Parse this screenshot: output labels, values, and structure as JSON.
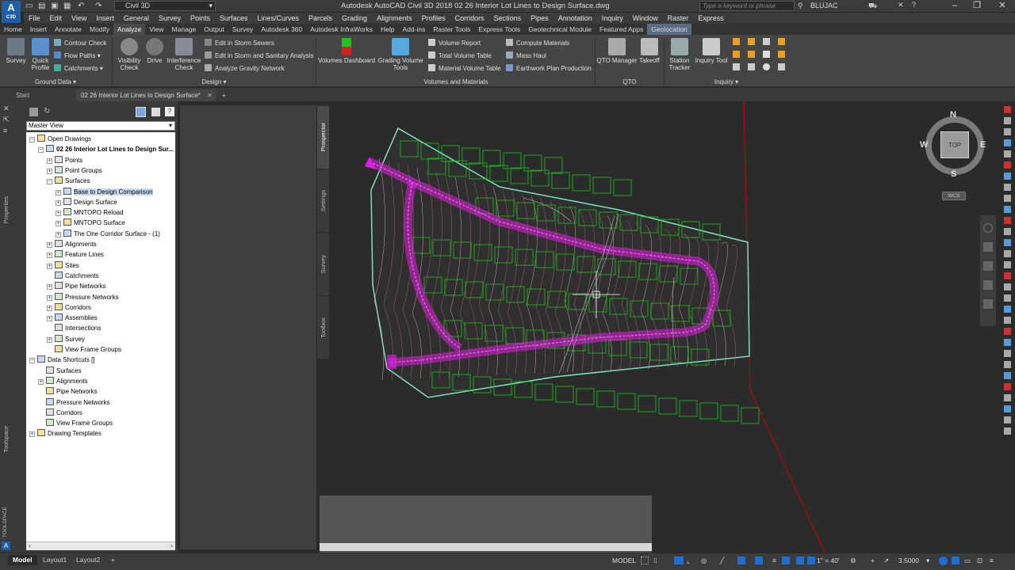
{
  "app": {
    "logo": "A",
    "logo_sub": "C3D",
    "title": "Autodesk AutoCAD Civil 3D 2018    02 26 Interior Lot Lines to Design Surface.dwg",
    "workspace": "Civil 3D",
    "search_placeholder": "Type a keyword or phrase",
    "user": "BLUJAC"
  },
  "menu": [
    "File",
    "Edit",
    "View",
    "Insert",
    "General",
    "Survey",
    "Points",
    "Surfaces",
    "Lines/Curves",
    "Parcels",
    "Grading",
    "Alignments",
    "Profiles",
    "Corridors",
    "Sections",
    "Pipes",
    "Annotation",
    "Inquiry",
    "Window",
    "Raster",
    "Express"
  ],
  "ribbon_tabs": [
    "Home",
    "Insert",
    "Annotate",
    "Modify",
    "Analyze",
    "View",
    "Manage",
    "Output",
    "Survey",
    "Autodesk 360",
    "Autodesk InfraWorks",
    "Help",
    "Add-ins",
    "Raster Tools",
    "Express Tools",
    "Geotechnical Module",
    "Featured Apps",
    "Geolocation"
  ],
  "ribbon": {
    "ground_data": {
      "title": "Ground Data",
      "survey": "Survey",
      "quick_profile": "Quick Profile",
      "contour_check": "Contour Check",
      "flow_paths": "Flow Paths",
      "catchments": "Catchments"
    },
    "design": {
      "title": "Design",
      "visibility_check": "Visibility Check",
      "drive": "Drive",
      "interference_check": "Interference Check",
      "edit_storm": "Edit in Storm Sewers",
      "edit_storm_sanitary": "Edit in Storm and Sanitary Analysis",
      "analyze_gravity": "Analyze Gravity Network"
    },
    "volumes": {
      "title": "Volumes and Materials",
      "volumes_dashboard": "Volumes Dashboard",
      "grading_volume_tools": "Grading Volume Tools",
      "volume_report": "Volume Report",
      "total_volume_table": "Total Volume Table",
      "material_volume_table": "Material Volume Table",
      "compute_materials": "Compute Materials",
      "mass_haul": "Mass Haul",
      "earthwork_plan": "Earthwork Plan Production"
    },
    "qto": {
      "title": "QTO",
      "qto_manager": "QTO Manager",
      "takeoff": "Takeoff"
    },
    "inquiry": {
      "title": "Inquiry",
      "station_tracker": "Station Tracker",
      "inquiry_tool": "Inquiry Tool"
    }
  },
  "file_tabs": {
    "start": "Start",
    "active": "02 26 Interior Lot Lines to Design Surface*"
  },
  "toolspace": {
    "view_select": "Master View",
    "side_label": "TOOLSPACE",
    "properties_label": "Properties",
    "toolspace_label": "Toolspace",
    "tree": [
      {
        "label": "Open Drawings",
        "indent": 0,
        "exp": "-"
      },
      {
        "label": "02 26 Interior Lot Lines to Design Sur...",
        "indent": 1,
        "exp": "-",
        "bold": true
      },
      {
        "label": "Points",
        "indent": 2,
        "exp": "+"
      },
      {
        "label": "Point Groups",
        "indent": 2,
        "exp": "+"
      },
      {
        "label": "Surfaces",
        "indent": 2,
        "exp": "-"
      },
      {
        "label": "Base to Design Comparison",
        "indent": 3,
        "exp": "+",
        "sel": true
      },
      {
        "label": "Design Surface",
        "indent": 3,
        "exp": "+"
      },
      {
        "label": "MNTOPO Reload",
        "indent": 3,
        "exp": "+"
      },
      {
        "label": "MNTOPO Surface",
        "indent": 3,
        "exp": "+"
      },
      {
        "label": "The One Corridor Surface - (1)",
        "indent": 3,
        "exp": "+"
      },
      {
        "label": "Alignments",
        "indent": 2,
        "exp": "+"
      },
      {
        "label": "Feature Lines",
        "indent": 2,
        "exp": "+"
      },
      {
        "label": "Sites",
        "indent": 2,
        "exp": "+"
      },
      {
        "label": "Catchments",
        "indent": 2,
        "exp": ""
      },
      {
        "label": "Pipe Networks",
        "indent": 2,
        "exp": "+"
      },
      {
        "label": "Pressure Networks",
        "indent": 2,
        "exp": "+"
      },
      {
        "label": "Corridors",
        "indent": 2,
        "exp": "+"
      },
      {
        "label": "Assemblies",
        "indent": 2,
        "exp": "+"
      },
      {
        "label": "Intersections",
        "indent": 2,
        "exp": ""
      },
      {
        "label": "Survey",
        "indent": 2,
        "exp": "+"
      },
      {
        "label": "View Frame Groups",
        "indent": 2,
        "exp": ""
      },
      {
        "label": "Data Shortcuts []",
        "indent": 0,
        "exp": "-"
      },
      {
        "label": "Surfaces",
        "indent": 1,
        "exp": ""
      },
      {
        "label": "Alignments",
        "indent": 1,
        "exp": "+"
      },
      {
        "label": "Pipe Networks",
        "indent": 1,
        "exp": ""
      },
      {
        "label": "Pressure Networks",
        "indent": 1,
        "exp": ""
      },
      {
        "label": "Corridors",
        "indent": 1,
        "exp": ""
      },
      {
        "label": "View Frame Groups",
        "indent": 1,
        "exp": ""
      },
      {
        "label": "Drawing Templates",
        "indent": 0,
        "exp": "+"
      }
    ]
  },
  "side_tabs": [
    "Prospector",
    "Settings",
    "Survey",
    "Toolbox"
  ],
  "viewcube": {
    "n": "N",
    "s": "S",
    "e": "E",
    "w": "W",
    "face": "TOP",
    "wcs": "WCS"
  },
  "layout_tabs": [
    "Model",
    "Layout1",
    "Layout2"
  ],
  "status": {
    "model": "MODEL",
    "scale": "1\" = 40'",
    "value": "3.5000"
  },
  "colors": {
    "surface_outline": "#7fe0c0",
    "corridor": "#e020e0",
    "contours": "#d07070",
    "lots": "#20c020",
    "boundary": "#cc0000"
  }
}
